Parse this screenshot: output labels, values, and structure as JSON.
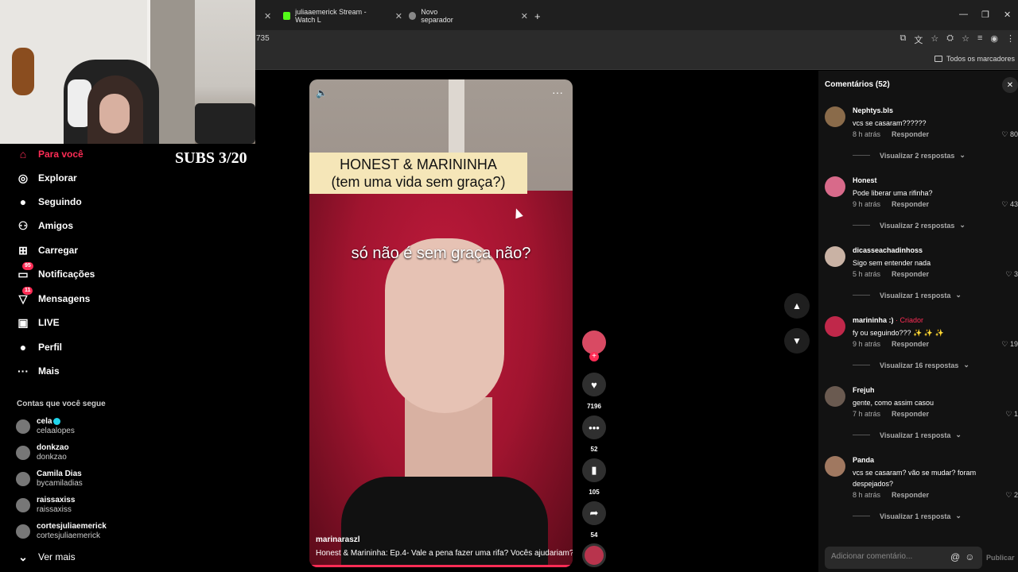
{
  "browser": {
    "tabs": [
      {
        "label": "juliaaemerick Stream - Watch L",
        "color": "#53fc18"
      },
      {
        "label": "Novo separador",
        "color": "#888888"
      }
    ],
    "address_fragment": "735",
    "bookmarks_label": "Todos os marcadores",
    "new_tab": "+",
    "close": "✕",
    "minimize": "—",
    "maximize": "❐"
  },
  "overlay": {
    "subs": "SUBS 3/20"
  },
  "sidebar": {
    "items": [
      {
        "label": "Para você",
        "icon": "home-icon",
        "glyph": "⌂"
      },
      {
        "label": "Explorar",
        "icon": "compass-icon",
        "glyph": "◎"
      },
      {
        "label": "Seguindo",
        "icon": "following-avatar-icon",
        "glyph": "●"
      },
      {
        "label": "Amigos",
        "icon": "friends-icon",
        "glyph": "⚇"
      },
      {
        "label": "Carregar",
        "icon": "upload-icon",
        "glyph": "⊞"
      },
      {
        "label": "Notificações",
        "icon": "notification-icon",
        "glyph": "▭",
        "badge": "95"
      },
      {
        "label": "Mensagens",
        "icon": "messages-icon",
        "glyph": "▽",
        "badge": "11"
      },
      {
        "label": "LIVE",
        "icon": "live-icon",
        "glyph": "▣"
      },
      {
        "label": "Perfil",
        "icon": "profile-avatar-icon",
        "glyph": "●"
      },
      {
        "label": "Mais",
        "icon": "more-icon",
        "glyph": "···"
      }
    ],
    "following_heading": "Contas que você segue",
    "following": [
      {
        "name": "cela",
        "username": "celaalopes",
        "verified": true
      },
      {
        "name": "donkzao",
        "username": "donkzao"
      },
      {
        "name": "Camila Dias",
        "username": "bycamiladias"
      },
      {
        "name": "raissaxiss",
        "username": "raissaxiss"
      },
      {
        "name": "cortesjuliaemerick",
        "username": "cortesjuliaemerick"
      }
    ],
    "see_more": "Ver mais"
  },
  "video": {
    "title_line1": "HONEST & MARININHA",
    "title_line2": "(tem uma vida sem graça?)",
    "caption": "só não é sem graça não?",
    "username": "marinaraszl",
    "description": "Honest & Marininha: Ep.4- Vale a pena fazer uma rifa? Vocês ajudariam?"
  },
  "actions": {
    "likes": "7196",
    "comments": "52",
    "saves": "105",
    "shares": "54"
  },
  "comments_panel": {
    "heading": "Comentários (52)",
    "reply_label": "Responder",
    "input_placeholder": "Adicionar comentário...",
    "post_label": "Publicar",
    "items": [
      {
        "user": "Nephtys.bls",
        "text": "vcs se casaram??????",
        "time": "8 h atrás",
        "likes": "80",
        "replies": "Visualizar 2 respostas",
        "avatar": "#8a6b4a"
      },
      {
        "user": "Honest",
        "text": "Pode liberar uma rifinha?",
        "time": "9 h atrás",
        "likes": "43",
        "replies": "Visualizar 2 respostas",
        "avatar": "#d86a8a"
      },
      {
        "user": "dicasseachadinhoss",
        "text": "Sigo sem entender nada",
        "time": "5 h atrás",
        "likes": "3",
        "replies": "Visualizar 1 resposta",
        "avatar": "#c9b2a4"
      },
      {
        "user": "marininha :)",
        "creator": "· Criador",
        "text": "fy ou seguindo??? ✨ ✨ ✨",
        "time": "9 h atrás",
        "likes": "19",
        "replies": "Visualizar 16 respostas",
        "avatar": "#c0284a"
      },
      {
        "user": "Frejuh",
        "text": "gente, como assim casou",
        "time": "7 h atrás",
        "likes": "1",
        "replies": "Visualizar 1 resposta",
        "avatar": "#6a5a50"
      },
      {
        "user": "Panda",
        "text": "vcs se casaram? vão se mudar? foram despejados?",
        "time": "8 h atrás",
        "likes": "2",
        "replies": "Visualizar 1 resposta",
        "avatar": "#a07860"
      }
    ]
  }
}
